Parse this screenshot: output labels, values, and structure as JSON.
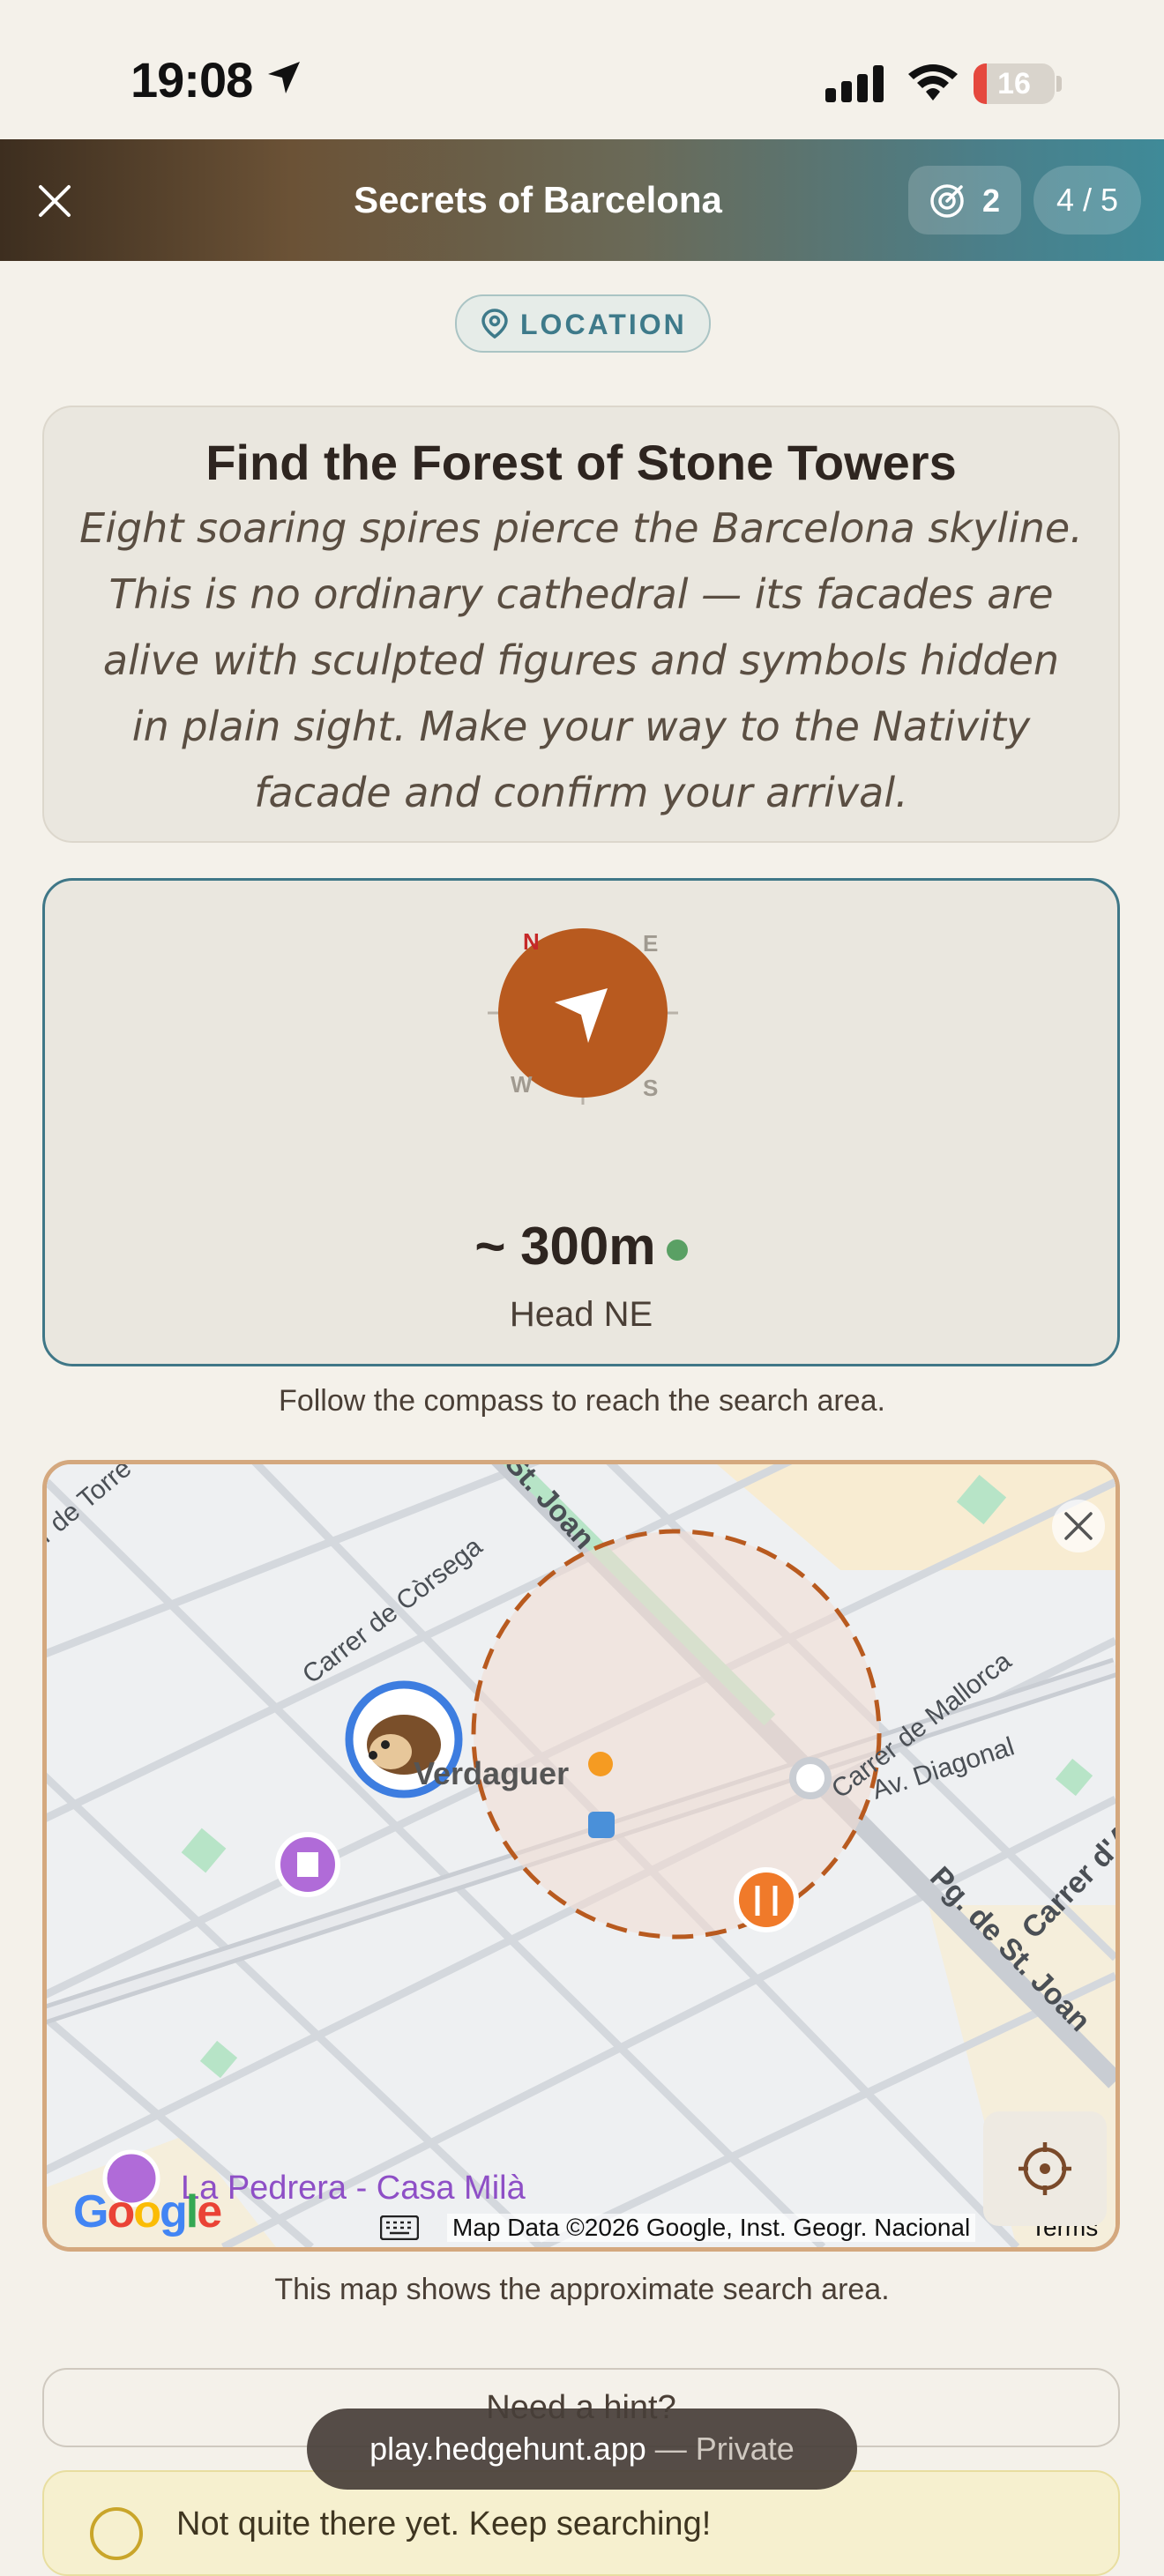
{
  "status_bar": {
    "time": "19:08",
    "battery": "16",
    "battery_level": 0.16,
    "icons": [
      "location-arrow-icon",
      "signal-icon",
      "wifi-icon",
      "battery-icon"
    ]
  },
  "header": {
    "title": "Secrets of Barcelona",
    "hints_count": "2",
    "progress": "4 / 5",
    "colors": {
      "gradient_start": "#3d2e1f",
      "gradient_end": "#3f8a98"
    }
  },
  "challenge": {
    "type_label": "LOCATION",
    "title": "Find the Forest of Stone Towers",
    "description": "Eight soaring spires pierce the Barcelona skyline. This is no ordinary cathedral — its facades are alive with sculpted figures and symbols hidden in plain sight. Make your way to the Nativity facade and confirm your arrival."
  },
  "compass": {
    "directions": {
      "n": "N",
      "e": "E",
      "s": "S",
      "w": "W"
    },
    "distance": "~ 300m",
    "heading": "Head NE",
    "hint_text": "Follow the compass to reach the search area.",
    "accent": "#b85a1f",
    "gps_status_color": "#5aa064"
  },
  "map": {
    "streets": [
      "Carrer de Còrsega",
      "Carrer de Mallorca",
      "Av. Diagonal",
      "Pg. de St. Joan",
      "Carrer d'A",
      "St. Joan",
      "r de Torre"
    ],
    "station_label": "Verdaguer",
    "poi_label": "La Pedrera - Casa Milà",
    "attribution": "Map Data ©2026 Google, Inst. Geogr. Nacional",
    "terms": "Terms",
    "logo": "Google",
    "caption": "This map shows the approximate search area."
  },
  "actions": {
    "hint_button": "Need a hint?",
    "feedback": "Not quite there yet. Keep searching!"
  },
  "browser": {
    "domain": "play.hedgehunt.app",
    "mode": " — Private"
  }
}
